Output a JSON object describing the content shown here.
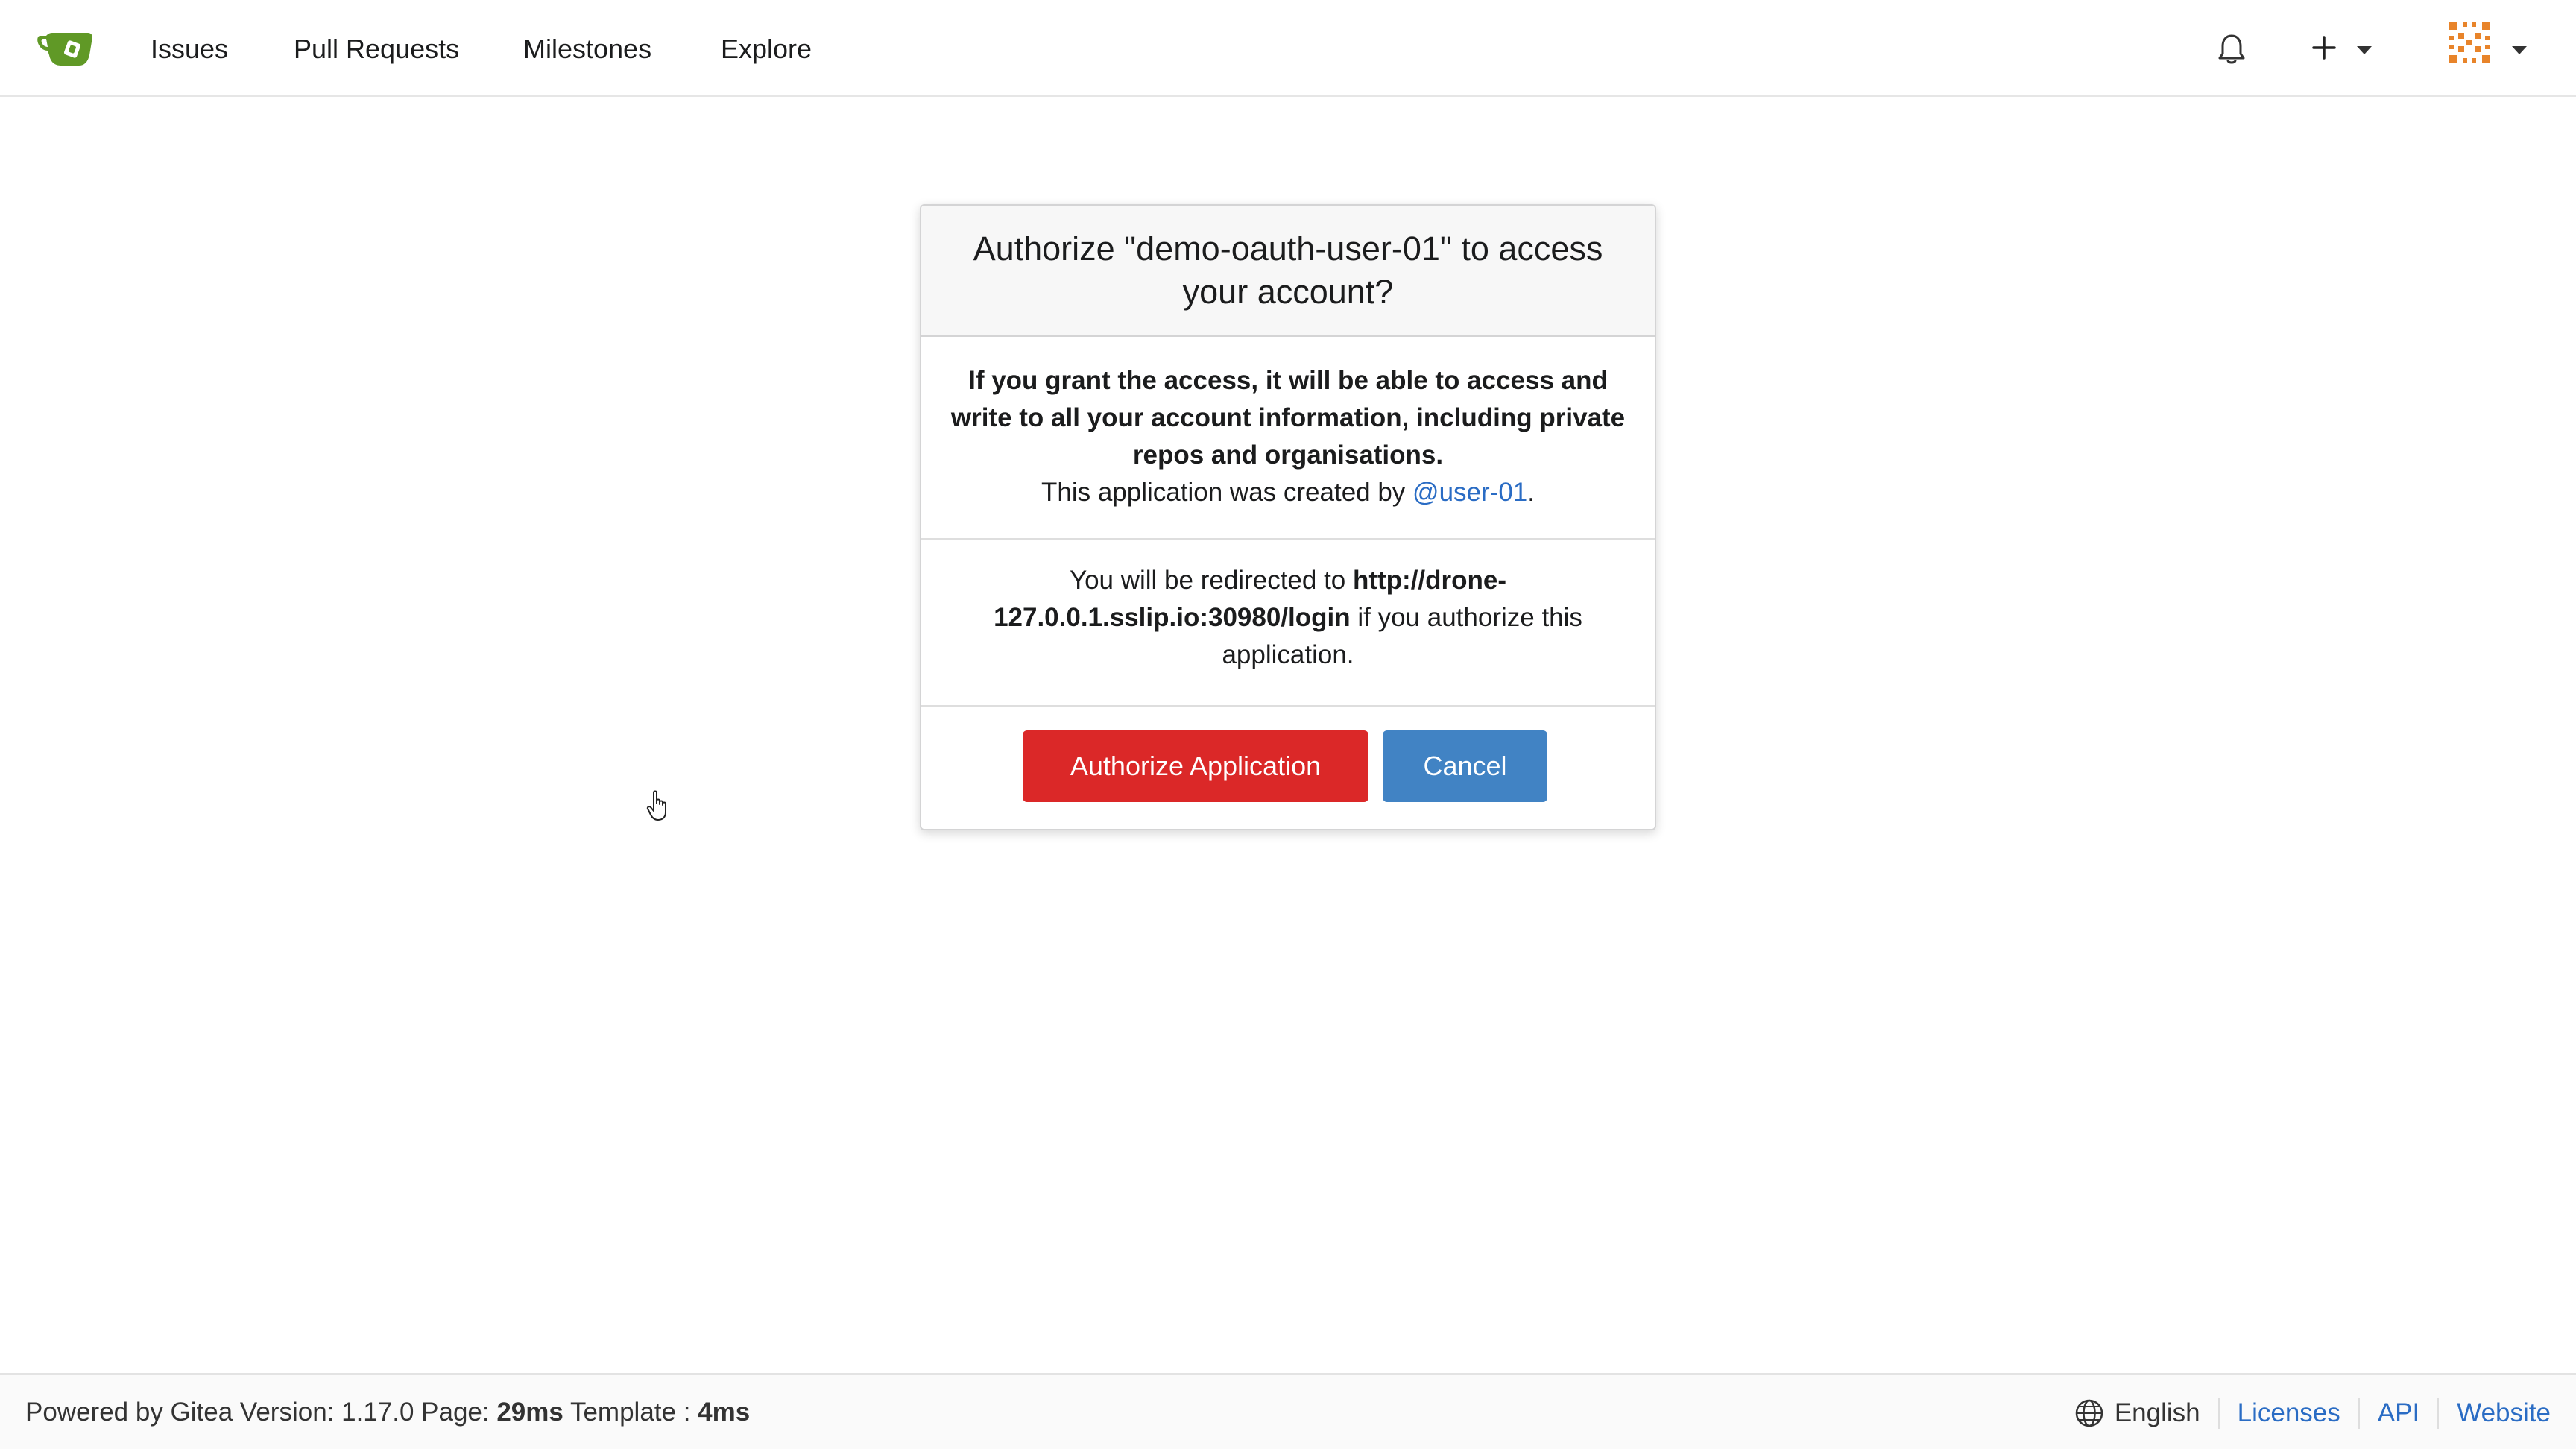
{
  "nav": {
    "links": [
      "Issues",
      "Pull Requests",
      "Milestones",
      "Explore"
    ]
  },
  "icons": {
    "logo": "gitea-logo-icon",
    "notifications": "bell-icon",
    "create": "plus-icon",
    "avatar": "user-avatar-icon",
    "language": "globe-icon"
  },
  "colors": {
    "authorize_button": "#db2828",
    "cancel_button": "#4183c4",
    "link": "#2a6cc4",
    "logo": "#609926"
  },
  "dialog": {
    "title": "Authorize \"demo-oauth-user-01\" to access your account?",
    "warning": "If you grant the access, it will be able to access and write to all your account information, including private repos and organisations.",
    "created_by_prefix": "This application was created by ",
    "creator": "@user-01",
    "created_by_suffix": ".",
    "redirect_prefix": "You will be redirected to ",
    "redirect_url": "http://drone-127.0.0.1.sslip.io:30980/login",
    "redirect_suffix": " if you authorize this application.",
    "authorize_label": "Authorize Application",
    "cancel_label": "Cancel"
  },
  "footer": {
    "powered_by": "Powered by Gitea Version: 1.17.0 Page: ",
    "page_time": "29ms",
    "template_label": " Template : ",
    "template_time": "4ms",
    "language": "English",
    "links": [
      "Licenses",
      "API",
      "Website"
    ]
  }
}
